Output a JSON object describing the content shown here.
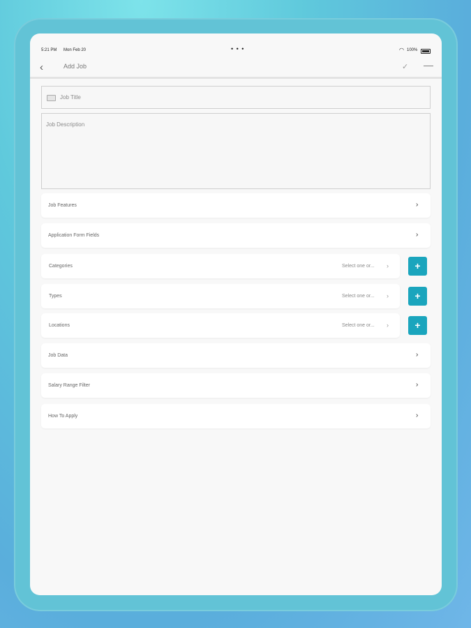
{
  "status": {
    "time": "5:21 PM",
    "date": "Mon Feb 20",
    "dots": "• • •",
    "battery": "100%"
  },
  "nav": {
    "back": "‹",
    "title": "Add Job",
    "check": "✓",
    "menu": "—"
  },
  "form": {
    "job_title_placeholder": "Job Title",
    "job_description_placeholder": "Job Description"
  },
  "rows": {
    "job_features": "Job Features",
    "application_form_fields": "Application Form Fields",
    "categories": "Categories",
    "types": "Types",
    "locations": "Locations",
    "job_data": "Job Data",
    "salary_range_filter": "Salary Range Filter",
    "how_to_apply": "How To Apply"
  },
  "select_placeholder": "Select one or...",
  "chevron": "›",
  "plus": "+",
  "colors": {
    "accent": "#1aa5bd",
    "background": "#f8f8f8"
  }
}
